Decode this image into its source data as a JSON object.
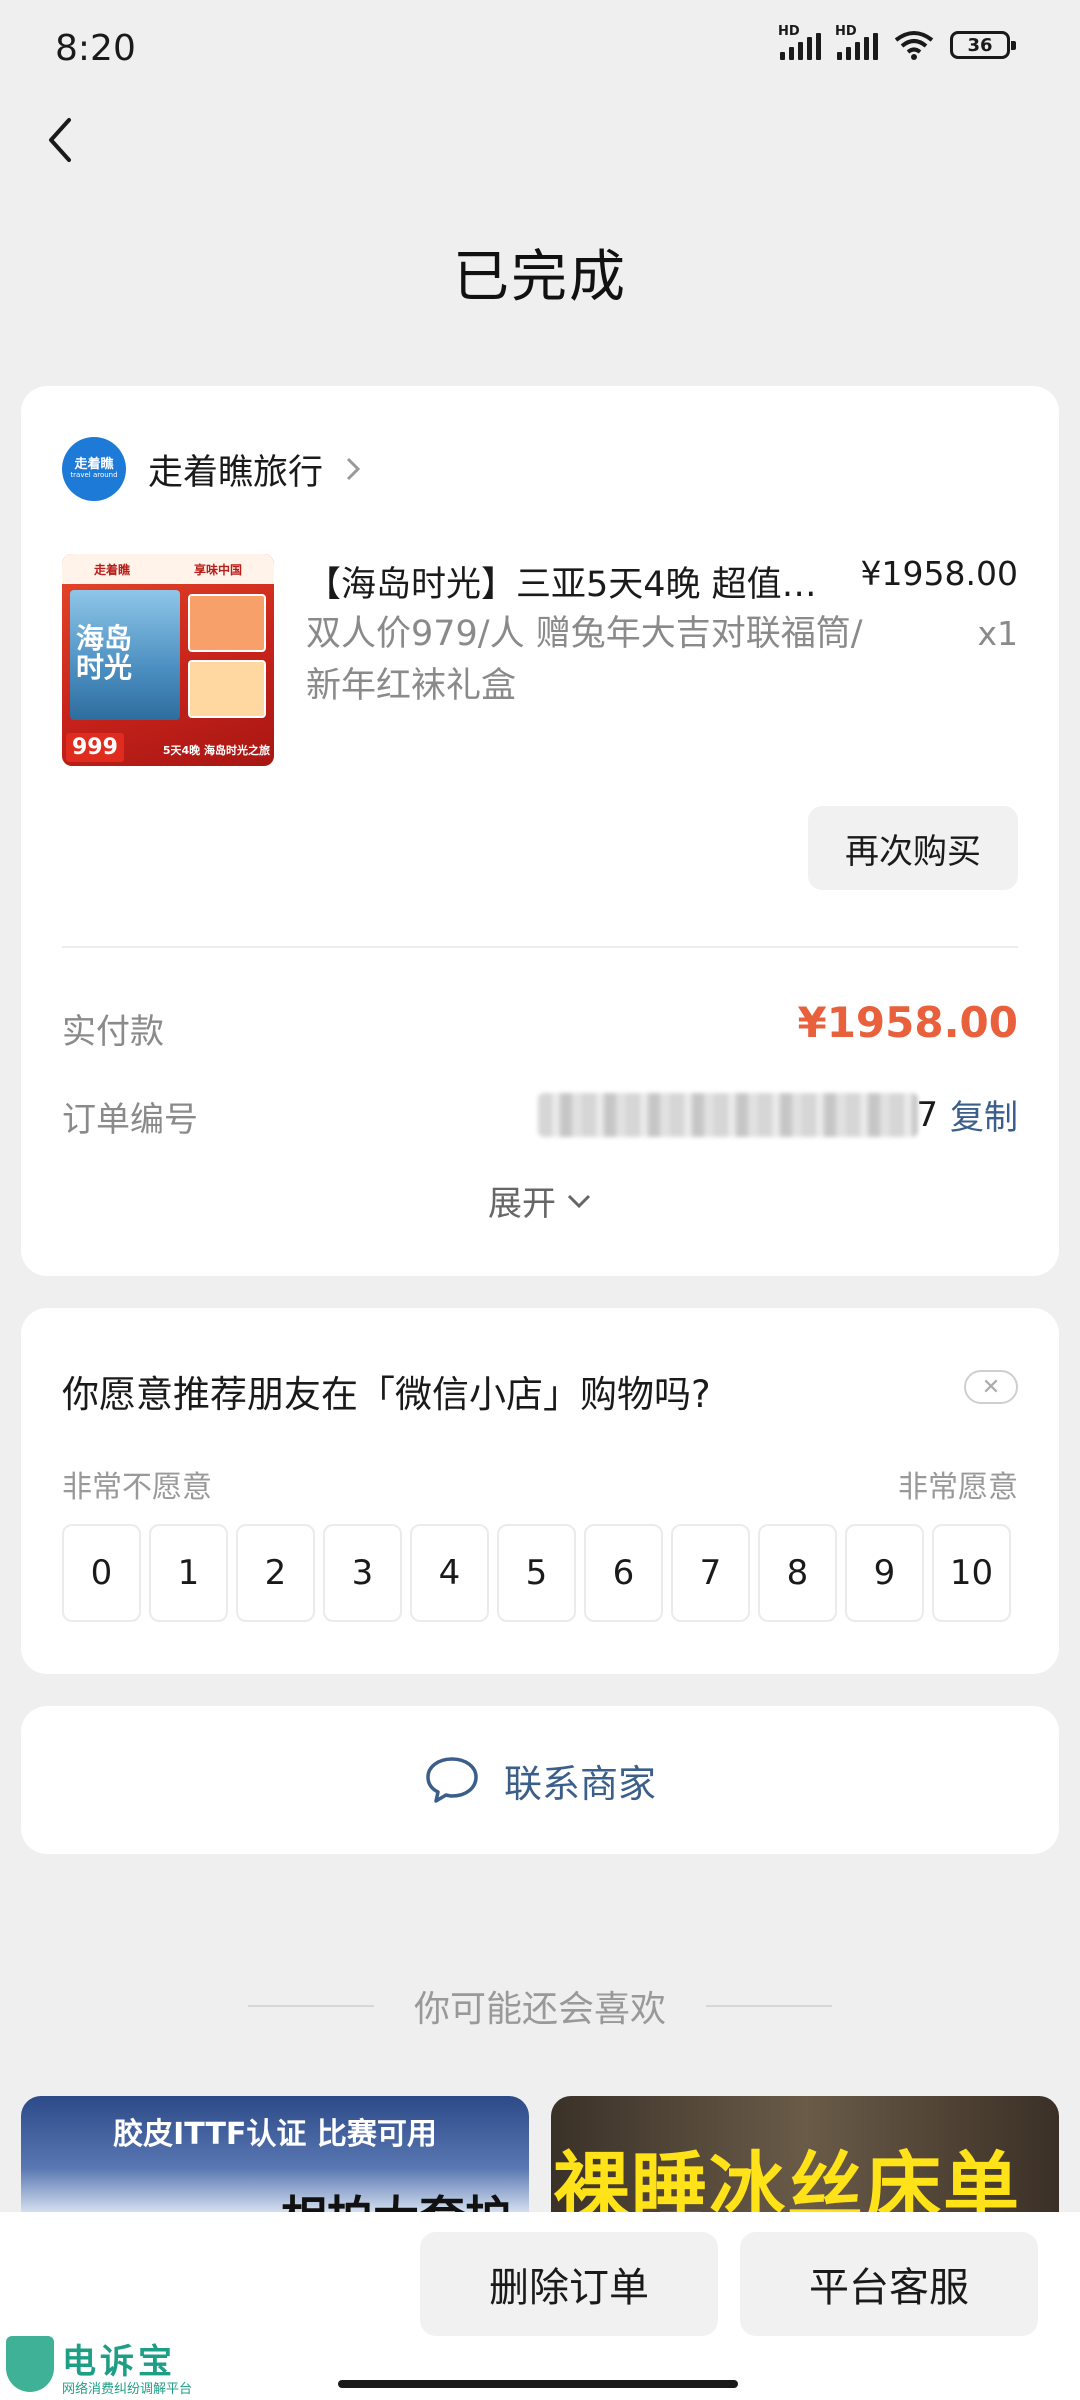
{
  "status_bar": {
    "time": "8:20",
    "battery": "36",
    "hd_label": "HD"
  },
  "header": {
    "title": "已完成"
  },
  "order": {
    "shop_name": "走着瞧旅行",
    "shop_logo_text": "走着瞧",
    "shop_logo_sub": "travel around",
    "product": {
      "title": "【海岛时光】三亚5天4晚 超值…",
      "description": "双人价979/人 赠兔年大吉对联福筒/新年红袜礼盒",
      "price": "¥1958.00",
      "quantity": "x1",
      "image_price_tag": "999",
      "image_top_left": "走着瞧",
      "image_top_right": "享味中国",
      "image_title": "海岛时光",
      "image_bottom": "5天4晚 海岛时光之旅"
    },
    "rebuy_label": "再次购买",
    "paid_label": "实付款",
    "paid_value": "¥1958.00",
    "order_no_label": "订单编号",
    "order_no_tail": "7",
    "copy_label": "复制",
    "expand_label": "展开"
  },
  "survey": {
    "question": "你愿意推荐朋友在「微信小店」购物吗?",
    "low_label": "非常不愿意",
    "high_label": "非常愿意",
    "scale": [
      "0",
      "1",
      "2",
      "3",
      "4",
      "5",
      "6",
      "7",
      "8",
      "9",
      "10"
    ]
  },
  "contact": {
    "label": "联系商家"
  },
  "recommend": {
    "title": "你可能还会喜欢",
    "item1_badge": "胶皮ITTF认证  比赛可用",
    "item1_sub": "相拍大套护",
    "item2_text": "裸睡冰丝床单"
  },
  "bottom_bar": {
    "delete_label": "删除订单",
    "service_label": "平台客服"
  },
  "watermark": {
    "name": "电诉宝",
    "sub": "网络消费纠纷调解平台"
  },
  "colors": {
    "accent_price": "#e8603c",
    "link_blue": "#3b5f8a",
    "background": "#efefef"
  },
  "icons": [
    "back-arrow-icon",
    "chevron-right-icon",
    "chevron-down-icon",
    "close-icon",
    "chat-bubble-icon",
    "signal-icon",
    "wifi-icon",
    "battery-icon"
  ]
}
